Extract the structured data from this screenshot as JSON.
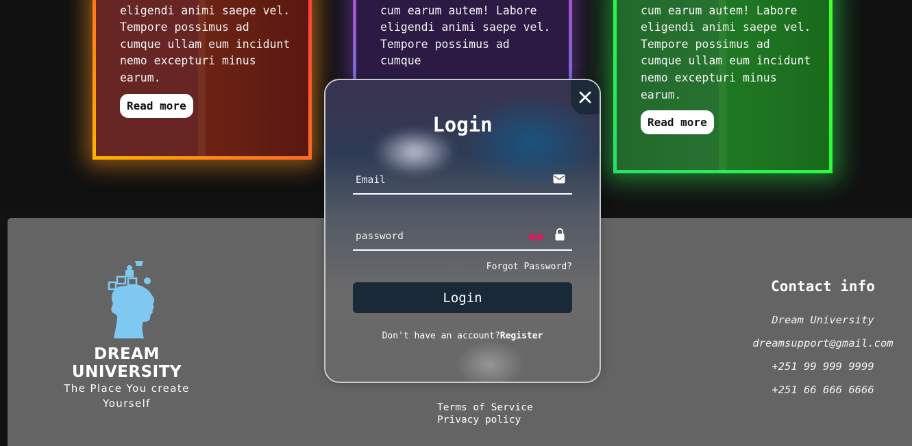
{
  "cards": [
    {
      "text": "cum earum autem! Labore eligendi animi saepe vel. Tempore possimus ad cumque ullam eum incidunt nemo excepturi minus earum.",
      "button": "Read more"
    },
    {
      "text": "Illum laboriosam ullam cum earum autem! Labore eligendi animi saepe vel. Tempore possimus ad cumque"
    },
    {
      "text": "Illum laboriosam ullam cum earum autem! Labore eligendi animi saepe vel. Tempore possimus ad cumque ullam eum incidunt nemo excepturi minus earum.",
      "button": "Read more"
    }
  ],
  "footer": {
    "brand": "DREAM UNIVERSITY",
    "tagline": "The Place You create Yourself",
    "terms": "Terms of Service",
    "privacy": "Privacy policy",
    "contact": {
      "title": "Contact info",
      "name": "Dream University",
      "email": "dreamsupport@gmail.com",
      "phone1": "+251 99 999 9999",
      "phone2": "+251 66 666 6666"
    }
  },
  "login": {
    "title": "Login",
    "email_placeholder": "Email",
    "password_placeholder": "password",
    "forgot": "Forgot Password?",
    "button": "Login",
    "register_prompt": "Don't have an account?",
    "register_link": "Register"
  },
  "icons": {
    "close": "close-icon",
    "email": "envelope-icon",
    "eye": "eye-icon",
    "lock": "lock-icon",
    "logo": "puzzle-head-icon"
  },
  "colors": {
    "accent_eye": "#e0185c",
    "login_button": "#1a2938",
    "footer_bg": "#646464",
    "logo": "#7ec8f2"
  }
}
